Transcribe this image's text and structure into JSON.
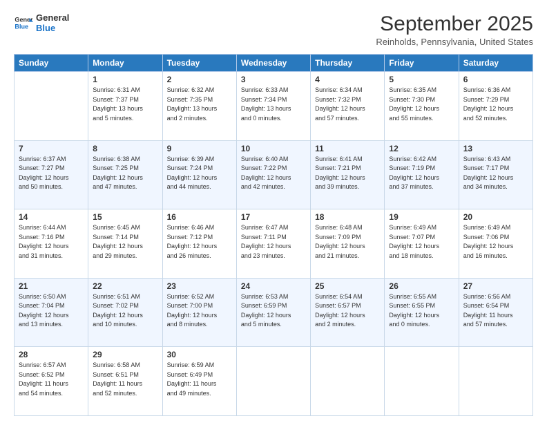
{
  "header": {
    "logo": {
      "line1": "General",
      "line2": "Blue"
    },
    "title": "September 2025",
    "subtitle": "Reinholds, Pennsylvania, United States"
  },
  "calendar": {
    "weekdays": [
      "Sunday",
      "Monday",
      "Tuesday",
      "Wednesday",
      "Thursday",
      "Friday",
      "Saturday"
    ],
    "weeks": [
      [
        {
          "date": "",
          "info": ""
        },
        {
          "date": "1",
          "info": "Sunrise: 6:31 AM\nSunset: 7:37 PM\nDaylight: 13 hours\nand 5 minutes."
        },
        {
          "date": "2",
          "info": "Sunrise: 6:32 AM\nSunset: 7:35 PM\nDaylight: 13 hours\nand 2 minutes."
        },
        {
          "date": "3",
          "info": "Sunrise: 6:33 AM\nSunset: 7:34 PM\nDaylight: 13 hours\nand 0 minutes."
        },
        {
          "date": "4",
          "info": "Sunrise: 6:34 AM\nSunset: 7:32 PM\nDaylight: 12 hours\nand 57 minutes."
        },
        {
          "date": "5",
          "info": "Sunrise: 6:35 AM\nSunset: 7:30 PM\nDaylight: 12 hours\nand 55 minutes."
        },
        {
          "date": "6",
          "info": "Sunrise: 6:36 AM\nSunset: 7:29 PM\nDaylight: 12 hours\nand 52 minutes."
        }
      ],
      [
        {
          "date": "7",
          "info": "Sunrise: 6:37 AM\nSunset: 7:27 PM\nDaylight: 12 hours\nand 50 minutes."
        },
        {
          "date": "8",
          "info": "Sunrise: 6:38 AM\nSunset: 7:25 PM\nDaylight: 12 hours\nand 47 minutes."
        },
        {
          "date": "9",
          "info": "Sunrise: 6:39 AM\nSunset: 7:24 PM\nDaylight: 12 hours\nand 44 minutes."
        },
        {
          "date": "10",
          "info": "Sunrise: 6:40 AM\nSunset: 7:22 PM\nDaylight: 12 hours\nand 42 minutes."
        },
        {
          "date": "11",
          "info": "Sunrise: 6:41 AM\nSunset: 7:21 PM\nDaylight: 12 hours\nand 39 minutes."
        },
        {
          "date": "12",
          "info": "Sunrise: 6:42 AM\nSunset: 7:19 PM\nDaylight: 12 hours\nand 37 minutes."
        },
        {
          "date": "13",
          "info": "Sunrise: 6:43 AM\nSunset: 7:17 PM\nDaylight: 12 hours\nand 34 minutes."
        }
      ],
      [
        {
          "date": "14",
          "info": "Sunrise: 6:44 AM\nSunset: 7:16 PM\nDaylight: 12 hours\nand 31 minutes."
        },
        {
          "date": "15",
          "info": "Sunrise: 6:45 AM\nSunset: 7:14 PM\nDaylight: 12 hours\nand 29 minutes."
        },
        {
          "date": "16",
          "info": "Sunrise: 6:46 AM\nSunset: 7:12 PM\nDaylight: 12 hours\nand 26 minutes."
        },
        {
          "date": "17",
          "info": "Sunrise: 6:47 AM\nSunset: 7:11 PM\nDaylight: 12 hours\nand 23 minutes."
        },
        {
          "date": "18",
          "info": "Sunrise: 6:48 AM\nSunset: 7:09 PM\nDaylight: 12 hours\nand 21 minutes."
        },
        {
          "date": "19",
          "info": "Sunrise: 6:49 AM\nSunset: 7:07 PM\nDaylight: 12 hours\nand 18 minutes."
        },
        {
          "date": "20",
          "info": "Sunrise: 6:49 AM\nSunset: 7:06 PM\nDaylight: 12 hours\nand 16 minutes."
        }
      ],
      [
        {
          "date": "21",
          "info": "Sunrise: 6:50 AM\nSunset: 7:04 PM\nDaylight: 12 hours\nand 13 minutes."
        },
        {
          "date": "22",
          "info": "Sunrise: 6:51 AM\nSunset: 7:02 PM\nDaylight: 12 hours\nand 10 minutes."
        },
        {
          "date": "23",
          "info": "Sunrise: 6:52 AM\nSunset: 7:00 PM\nDaylight: 12 hours\nand 8 minutes."
        },
        {
          "date": "24",
          "info": "Sunrise: 6:53 AM\nSunset: 6:59 PM\nDaylight: 12 hours\nand 5 minutes."
        },
        {
          "date": "25",
          "info": "Sunrise: 6:54 AM\nSunset: 6:57 PM\nDaylight: 12 hours\nand 2 minutes."
        },
        {
          "date": "26",
          "info": "Sunrise: 6:55 AM\nSunset: 6:55 PM\nDaylight: 12 hours\nand 0 minutes."
        },
        {
          "date": "27",
          "info": "Sunrise: 6:56 AM\nSunset: 6:54 PM\nDaylight: 11 hours\nand 57 minutes."
        }
      ],
      [
        {
          "date": "28",
          "info": "Sunrise: 6:57 AM\nSunset: 6:52 PM\nDaylight: 11 hours\nand 54 minutes."
        },
        {
          "date": "29",
          "info": "Sunrise: 6:58 AM\nSunset: 6:51 PM\nDaylight: 11 hours\nand 52 minutes."
        },
        {
          "date": "30",
          "info": "Sunrise: 6:59 AM\nSunset: 6:49 PM\nDaylight: 11 hours\nand 49 minutes."
        },
        {
          "date": "",
          "info": ""
        },
        {
          "date": "",
          "info": ""
        },
        {
          "date": "",
          "info": ""
        },
        {
          "date": "",
          "info": ""
        }
      ]
    ]
  }
}
